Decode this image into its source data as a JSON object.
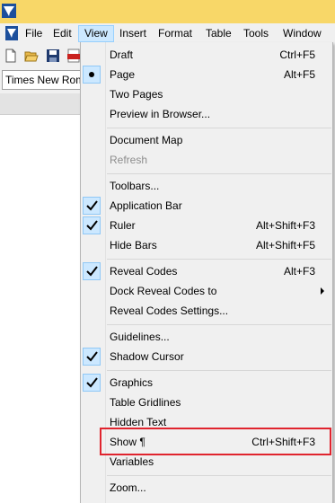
{
  "menubar": {
    "items": [
      "File",
      "Edit",
      "View",
      "Insert",
      "Format",
      "Table",
      "Tools",
      "Window"
    ],
    "active": "View"
  },
  "fontbar": {
    "font_name": "Times New Rom"
  },
  "view_menu": {
    "items": [
      {
        "label": "Draft",
        "shortcut": "Ctrl+F5",
        "mark": "none",
        "enabled": true
      },
      {
        "label": "Page",
        "shortcut": "Alt+F5",
        "mark": "bullet",
        "enabled": true
      },
      {
        "label": "Two Pages",
        "shortcut": "",
        "mark": "none",
        "enabled": true
      },
      {
        "label": "Preview in Browser...",
        "shortcut": "",
        "mark": "none",
        "enabled": true
      },
      {
        "label": "Document Map",
        "shortcut": "",
        "mark": "none",
        "enabled": true
      },
      {
        "label": "Refresh",
        "shortcut": "",
        "mark": "none",
        "enabled": false
      },
      {
        "label": "Toolbars...",
        "shortcut": "",
        "mark": "none",
        "enabled": true
      },
      {
        "label": "Application Bar",
        "shortcut": "",
        "mark": "check",
        "enabled": true
      },
      {
        "label": "Ruler",
        "shortcut": "Alt+Shift+F3",
        "mark": "check",
        "enabled": true
      },
      {
        "label": "Hide Bars",
        "shortcut": "Alt+Shift+F5",
        "mark": "none",
        "enabled": true
      },
      {
        "label": "Reveal Codes",
        "shortcut": "Alt+F3",
        "mark": "check",
        "enabled": true
      },
      {
        "label": "Dock Reveal Codes to",
        "shortcut": "",
        "mark": "none",
        "enabled": true,
        "submenu": true
      },
      {
        "label": "Reveal Codes Settings...",
        "shortcut": "",
        "mark": "none",
        "enabled": true
      },
      {
        "label": "Guidelines...",
        "shortcut": "",
        "mark": "none",
        "enabled": true
      },
      {
        "label": "Shadow Cursor",
        "shortcut": "",
        "mark": "check",
        "enabled": true
      },
      {
        "label": "Graphics",
        "shortcut": "",
        "mark": "check",
        "enabled": true
      },
      {
        "label": "Table Gridlines",
        "shortcut": "",
        "mark": "none",
        "enabled": true
      },
      {
        "label": "Hidden Text",
        "shortcut": "",
        "mark": "none",
        "enabled": true
      },
      {
        "label": "Show ¶",
        "shortcut": "Ctrl+Shift+F3",
        "mark": "none",
        "enabled": true,
        "highlighted": true
      },
      {
        "label": "Variables",
        "shortcut": "",
        "mark": "none",
        "enabled": true
      },
      {
        "label": "Zoom...",
        "shortcut": "",
        "mark": "none",
        "enabled": true
      }
    ]
  },
  "colors": {
    "title_bar": "#f8d768",
    "menu_active": "#cce8ff",
    "highlight_frame": "#e0242e"
  },
  "icons": [
    "app-logo-icon",
    "document-icon",
    "new-document-icon",
    "open-folder-icon",
    "save-disk-icon",
    "pdf-icon",
    "checkmark-icon",
    "submenu-arrow-icon"
  ]
}
